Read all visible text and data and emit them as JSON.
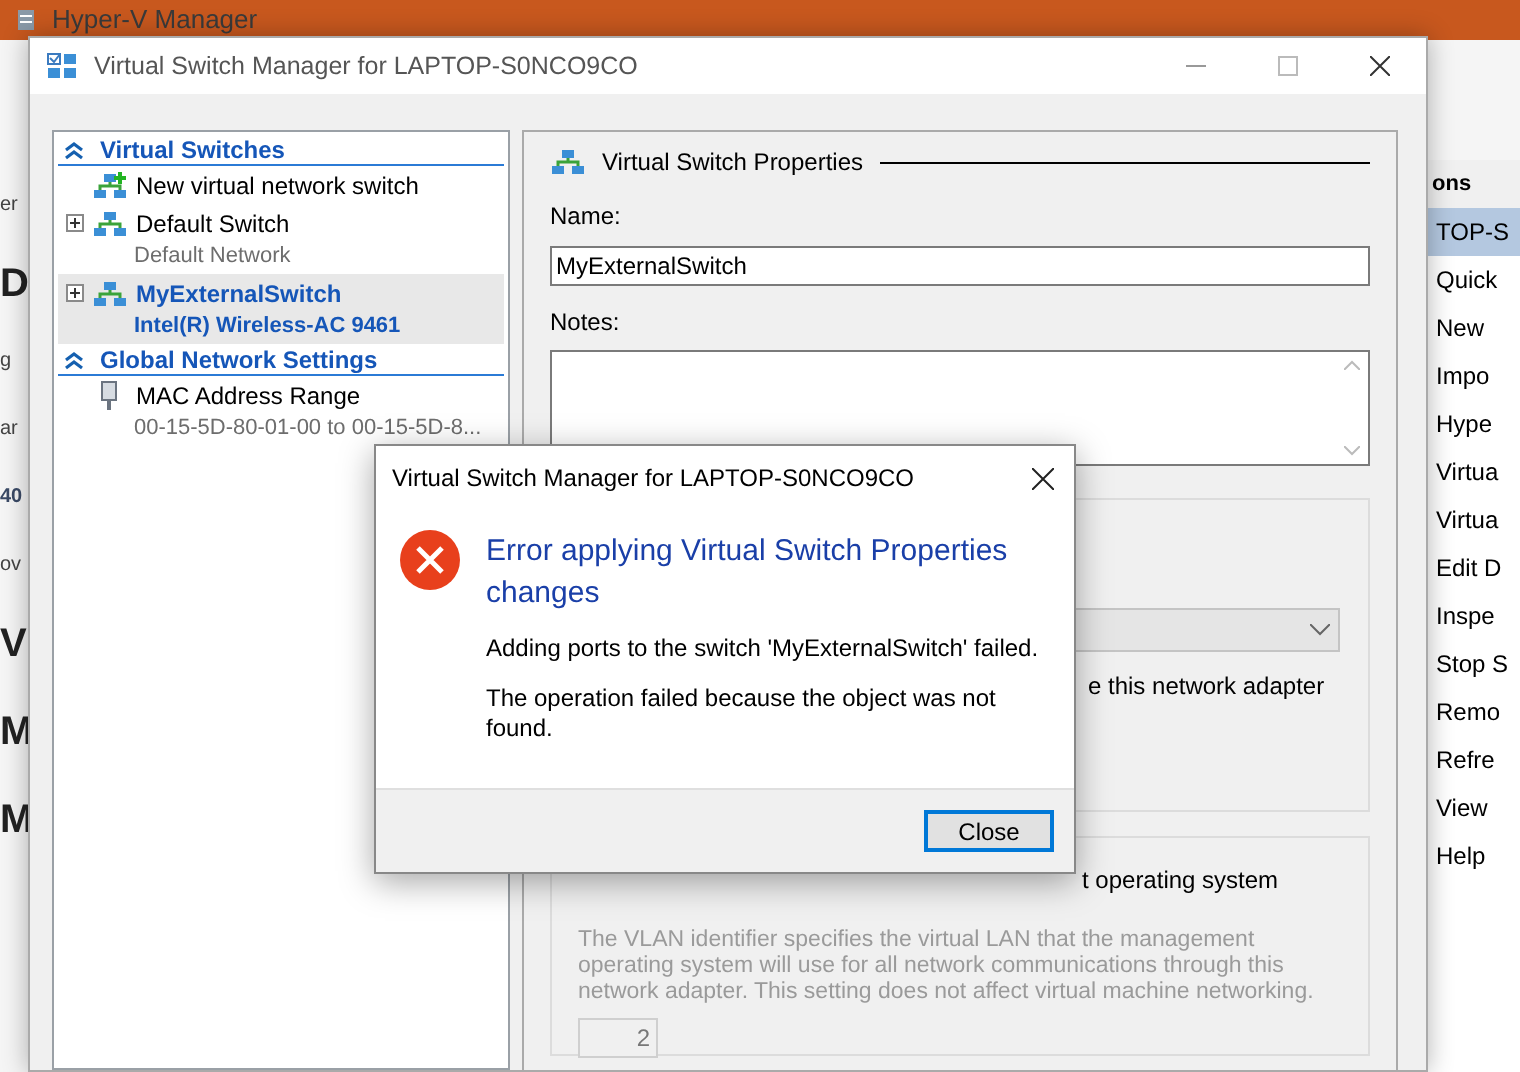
{
  "background_window": {
    "title": "Hyper-V Manager",
    "left_edge_texts": [
      {
        "text": "er",
        "kind": "plain"
      },
      {
        "text": "D",
        "kind": "large"
      },
      {
        "text": "g",
        "kind": "plain"
      },
      {
        "text": "ar",
        "kind": "plain"
      },
      {
        "text": "40",
        "kind": "bold"
      },
      {
        "text": "ov",
        "kind": "plain"
      },
      {
        "text": "V",
        "kind": "large"
      },
      {
        "text": "M",
        "kind": "large"
      },
      {
        "text": "M",
        "kind": "large"
      }
    ]
  },
  "actions_pane": {
    "header": "ons",
    "items": [
      {
        "label": "TOP-S",
        "selected": true
      },
      {
        "label": "Quick",
        "selected": false
      },
      {
        "label": "New",
        "selected": false
      },
      {
        "label": "Impo",
        "selected": false
      },
      {
        "label": "Hype",
        "selected": false
      },
      {
        "label": "Virtua",
        "selected": false
      },
      {
        "label": "Virtua",
        "selected": false
      },
      {
        "label": "Edit D",
        "selected": false
      },
      {
        "label": "Inspe",
        "selected": false
      },
      {
        "label": "Stop S",
        "selected": false
      },
      {
        "label": "Remo",
        "selected": false
      },
      {
        "label": "Refre",
        "selected": false
      },
      {
        "label": "View",
        "selected": false
      },
      {
        "label": "Help",
        "selected": false
      }
    ]
  },
  "window": {
    "title": "Virtual Switch Manager for LAPTOP-S0NCO9CO"
  },
  "tree": [
    {
      "label": "Virtual Switches",
      "expanded": true,
      "children": [
        {
          "kind": "new",
          "label": "New virtual network switch",
          "selected": false
        },
        {
          "kind": "switch",
          "label": "Default Switch",
          "sublabel": "Default Network",
          "selected": false
        },
        {
          "kind": "switch",
          "label": "MyExternalSwitch",
          "sublabel": "Intel(R) Wireless-AC 9461",
          "selected": true
        }
      ]
    },
    {
      "label": "Global Network Settings",
      "expanded": true,
      "children": [
        {
          "kind": "mac",
          "label": "MAC Address Range",
          "sublabel": "00-15-5D-80-01-00 to 00-15-5D-8...",
          "selected": false
        }
      ]
    }
  ],
  "properties": {
    "title": "Virtual Switch Properties",
    "name_label": "Name:",
    "name_value": "MyExternalSwitch",
    "notes_label": "Notes:",
    "adapter_option_text": "e this network adapter",
    "vlan_option_text": "t operating system",
    "vlan_description": "The VLAN identifier specifies the virtual LAN that the management operating system will use for all network communications through this network adapter. This setting does not affect virtual machine networking.",
    "vlan_id": "2"
  },
  "dialog": {
    "title": "Virtual Switch Manager for LAPTOP-S0NCO9CO",
    "heading": "Error applying Virtual Switch Properties changes",
    "messages": [
      "Adding ports to the switch 'MyExternalSwitch' failed.",
      "The operation failed because the object was not found."
    ],
    "button": "Close"
  }
}
